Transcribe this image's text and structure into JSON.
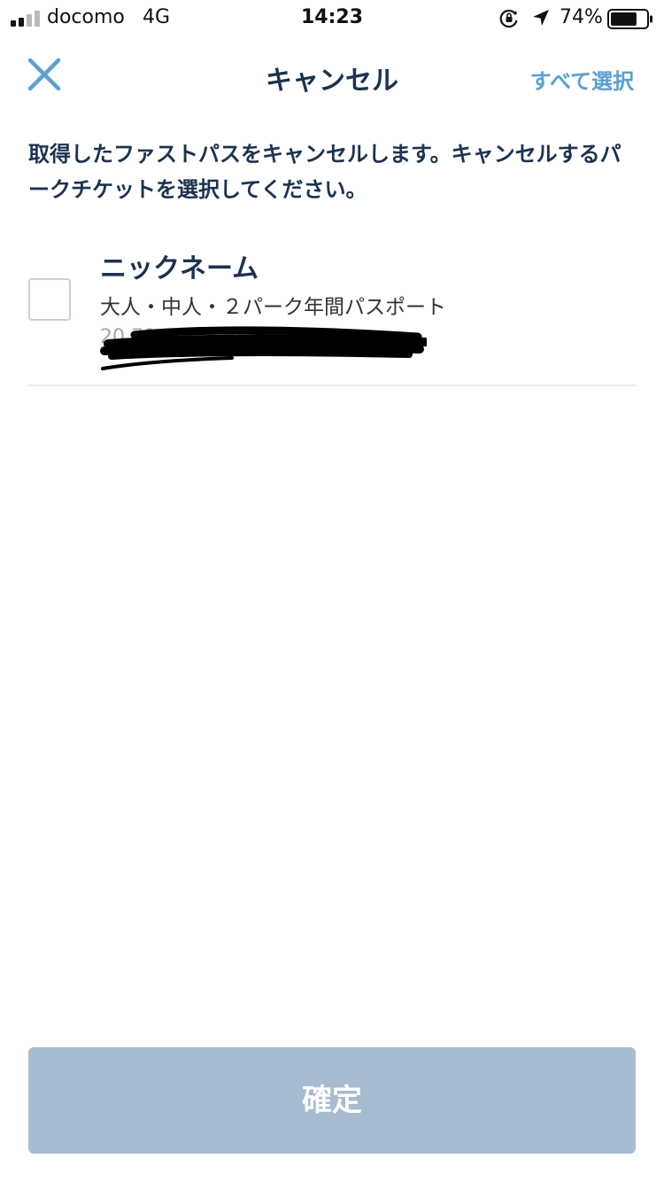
{
  "status_bar": {
    "carrier": "docomo",
    "network": "4G",
    "time": "14:23",
    "battery_percent": "74%",
    "battery_level": 0.74,
    "icons": [
      "signal-icon",
      "rotation-lock-icon",
      "location-arrow-icon",
      "battery-icon"
    ]
  },
  "nav": {
    "close_icon": "close-icon",
    "title": "キャンセル",
    "select_all_label": "すべて選択"
  },
  "description": "取得したファストパスをキャンセルします。キャンセルするパークチケットを選択してください。",
  "ticket": {
    "name": "ニックネーム",
    "type": "大人・中人・２パーク年間パスポート",
    "id_partial": "20        70 0  01519 0",
    "checked": false
  },
  "confirm_button": {
    "label": "確定",
    "enabled": false
  },
  "colors": {
    "primary_text": "#1b3352",
    "accent": "#5aa0d4",
    "disabled_button": "#a7bbd1",
    "checkbox_border": "#c6d0dc"
  }
}
